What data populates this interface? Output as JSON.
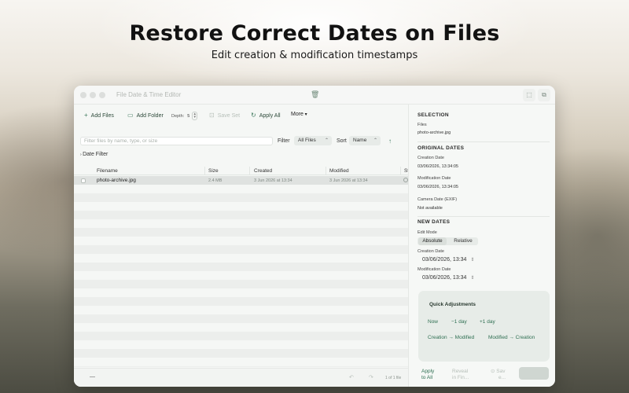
{
  "hero": {
    "title": "Restore Correct Dates on Files",
    "subtitle": "Edit creation & modification timestamps"
  },
  "window": {
    "title": "File Date & Time Editor"
  },
  "toolbar": {
    "add_files": "Add Files",
    "add_folder": "Add Folder",
    "depth_label": "Depth:",
    "depth_value": "5",
    "save_set": "Save Set",
    "apply_all": "Apply All",
    "more": "More"
  },
  "filterbar": {
    "search_placeholder": "Filter files by name, type, or size",
    "filter_label": "Filter",
    "filter_value": "All Files",
    "sort_label": "Sort",
    "sort_value": "Name",
    "date_filter": "Date Filter"
  },
  "table": {
    "columns": [
      "Filename",
      "Size",
      "Created",
      "Modified",
      "St"
    ],
    "rows": [
      {
        "filename": "photo-archive.jpg",
        "size": "2.4 MB",
        "created": "3 Jun 2026 at 13:34",
        "modified": "3 Jun 2026 at 13:34"
      }
    ]
  },
  "statusbar": {
    "minus": "—",
    "page_info": "1 of 1 file"
  },
  "inspector": {
    "selection_title": "SELECTION",
    "files_label": "Files",
    "files_value": "photo-archive.jpg",
    "original_title": "ORIGINAL DATES",
    "orig_creation_label": "Creation Date",
    "orig_creation_value": "03/06/2026, 13:34:05",
    "orig_modification_label": "Modification Date",
    "orig_modification_value": "03/06/2026, 13:34:05",
    "camera_label": "Camera Date (EXIF)",
    "camera_value": "Not available",
    "new_title": "NEW DATES",
    "edit_mode_label": "Edit Mode",
    "mode_absolute": "Absolute",
    "mode_relative": "Relative",
    "new_creation_label": "Creation Date",
    "new_creation_value": "03/06/2026, 13:34",
    "new_modification_label": "Modification Date",
    "new_modification_value": "03/06/2026, 13:34",
    "quick_title": "Quick Adjustments",
    "quick_now": "Now",
    "quick_minus_day": "−1 day",
    "quick_plus_day": "+1 day",
    "quick_creation_to_modified": "Creation → Modified",
    "quick_modified_to_creation": "Modified → Creation",
    "apply_to_all_1": "Apply",
    "apply_to_all_2": "to All",
    "reveal_1": "Reveal",
    "reveal_2": "in Fin...",
    "save_1": "Sav",
    "save_2": "e..."
  },
  "colors": {
    "accent": "#2f6f52",
    "selected_row": "#dfe2e0"
  }
}
